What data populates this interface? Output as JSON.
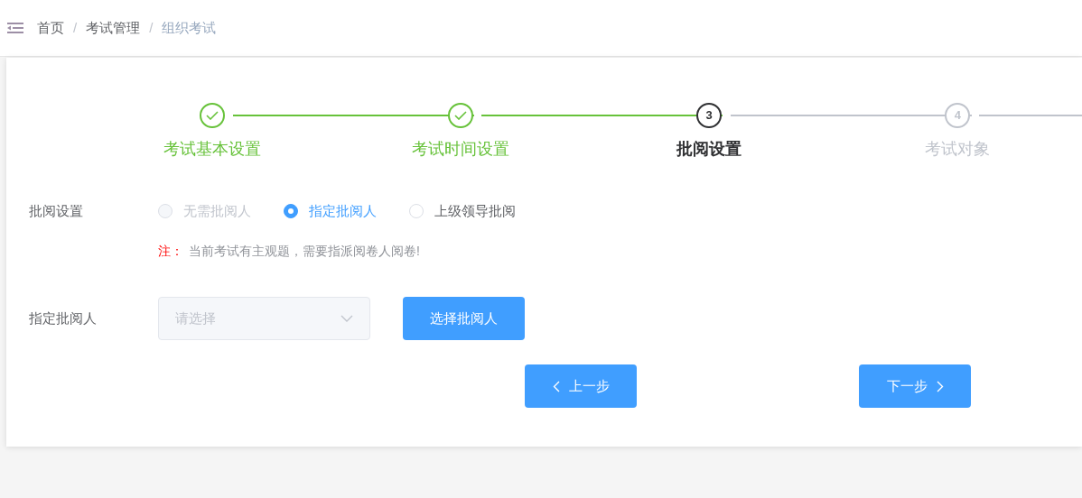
{
  "breadcrumb": [
    "首页",
    "考试管理",
    "组织考试"
  ],
  "breadcrumb_separators": [
    "/",
    "/"
  ],
  "steps": [
    {
      "title": "考试基本设置",
      "done": true,
      "active": false
    },
    {
      "title": "考试时间设置",
      "done": true,
      "active": false
    },
    {
      "number": "3",
      "title": "批阅设置",
      "done": false,
      "active": true
    },
    {
      "number": "4",
      "title": "考试对象",
      "done": false,
      "active": false
    }
  ],
  "review_setting": {
    "label": "批阅设置",
    "options": [
      {
        "label": "无需批阅人",
        "selected": false,
        "disabled": true
      },
      {
        "label": "指定批阅人",
        "selected": true,
        "disabled": false
      },
      {
        "label": "上级领导批阅",
        "selected": false,
        "disabled": false
      }
    ]
  },
  "note": {
    "prefix": "注：",
    "text": "当前考试有主观题，需要指派阅卷人阅卷!"
  },
  "reviewer": {
    "label": "指定批阅人",
    "placeholder": "请选择",
    "button": "选择批阅人"
  },
  "prev_button": "上一步",
  "next_button": "下一步"
}
